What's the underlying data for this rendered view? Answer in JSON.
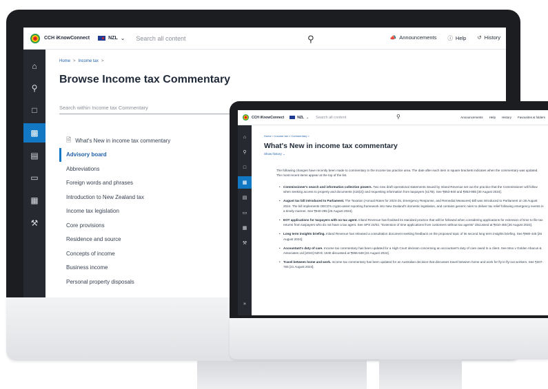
{
  "app": {
    "brand": "CCH iKnowConnect",
    "region": "NZL",
    "search_placeholder": "Search all content",
    "top_actions": [
      "Announcements",
      "Help",
      "History"
    ],
    "small_top_actions": [
      "Announcements",
      "Help",
      "History",
      "Favourites & folders"
    ]
  },
  "browse": {
    "breadcrumb": [
      "Home",
      "Income tax"
    ],
    "title": "Browse Income tax Commentary",
    "search_placeholder": "Search within Income tax Commentary",
    "items": [
      "What's New in income tax commentary",
      "Advisory board",
      "Abbreviations",
      "Foreign words and phrases",
      "Introduction to New Zealand tax",
      "Income tax legislation",
      "Core provisions",
      "Residence and source",
      "Concepts of income",
      "Business income",
      "Personal property disposals"
    ],
    "selected_index": 1
  },
  "whatsnew": {
    "breadcrumb": [
      "Home",
      "Income tax",
      "Commentary"
    ],
    "title": "What's New in income tax commentary",
    "show_history": "Show history",
    "intro": "The following changes have recently been made to commentary in the income tax practice area. The date after each item in square brackets indicates when the commentary was updated. The most recent items appear at the top of the list.",
    "bullets": [
      {
        "head": "Commissioner's search and information collection powers.",
        "body": "Two new draft operational statements issued by Inland Revenue set out the practice that the Commissioner will follow when seeking access to property and documents (s16(2)) and requesting information from taxpayers (s17B). See ¶853-940 and ¶853-955 [30 August 2024]."
      },
      {
        "head": "August tax bill introduced to Parliament.",
        "body": "The Taxation (Annual Rates for 2024-25, Emergency Response, and Remedial Measures) Bill was introduced to Parliament on 26 August 2024. The bill implements OECD's crypto-asset reporting framework into New Zealand's domestic legislation, and contains generic rules to deliver tax relief following emergency events in a timely manner. See ¶940-295 [26 August 2024]."
      },
      {
        "head": "EOT applications for taxpayers with no tax agent.",
        "body": "Inland Revenue has finalised its standard practice that will be followed when considering applications for extension of time to file tax returns from taxpayers who do not have a tax agent. See SPS 24/02, \"Extension of time applications from customers without tax agents\" discussed at ¶810-455 [26 August 2024]."
      },
      {
        "head": "Long term insights briefing.",
        "body": "Inland Revenue has released a consultation document seeking feedback on the proposed topic of its second long term insights briefing. See ¶980-445 [26 August 2024]."
      },
      {
        "head": "Accountant's duty of care.",
        "body": "Income tax commentary has been updated for a High Court decision concerning an accountant's duty of care owed to a client. See Moo v Golden Abacus & Associates Ltd [2024] NZHC 1040 discussed at ¶865-548 [22 August 2024]."
      },
      {
        "head": "Travel between home and work.",
        "body": "Income tax commentary has been updated for an Australian decision that discusses travel between home and work for fly-in fly-out workers. See ¶207-765 [21 August 2024]."
      }
    ]
  }
}
